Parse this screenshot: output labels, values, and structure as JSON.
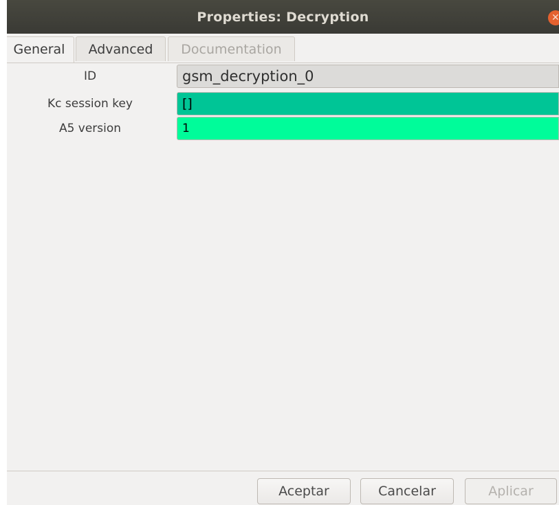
{
  "window": {
    "title": "Properties: Decryption",
    "close_icon": "close-icon"
  },
  "tabs": [
    {
      "label": "General",
      "active": true,
      "enabled": true
    },
    {
      "label": "Advanced",
      "active": false,
      "enabled": true
    },
    {
      "label": "Documentation",
      "active": false,
      "enabled": false
    }
  ],
  "fields": {
    "id": {
      "label": "ID",
      "value": "gsm_decryption_0",
      "color": "#dcdbd9"
    },
    "kc_session_key": {
      "label": "Kc session key",
      "value": "[]",
      "color": "#00c596"
    },
    "a5_version": {
      "label": "A5 version",
      "value": "1",
      "color": "#00fc9a"
    }
  },
  "buttons": {
    "aceptar": "Aceptar",
    "cancelar": "Cancelar",
    "aplicar": "Aplicar"
  }
}
